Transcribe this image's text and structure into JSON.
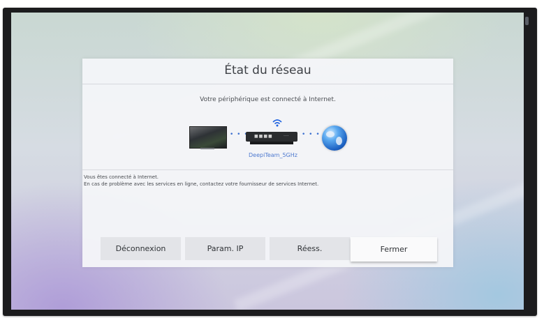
{
  "dialog": {
    "title": "État du réseau",
    "message": "Votre périphérique est connecté à Internet.",
    "ssid": "DeepiTeam_5GHz",
    "info_line1": "Vous êtes connecté à Internet.",
    "info_line2": "En cas de problème avec les services en ligne, contactez votre fournisseur de services Internet."
  },
  "buttons": {
    "disconnect": "Déconnexion",
    "ip_settings": "Param. IP",
    "retry": "Réess.",
    "close": "Fermer"
  },
  "diagram": {
    "connector": "• • • •",
    "icons": [
      "tv-icon",
      "wifi-icon",
      "router-icon",
      "globe-icon"
    ]
  },
  "colors": {
    "accent": "#1f63e0",
    "ssid_text": "#4d79cf",
    "focused_button": "#fafafb"
  }
}
